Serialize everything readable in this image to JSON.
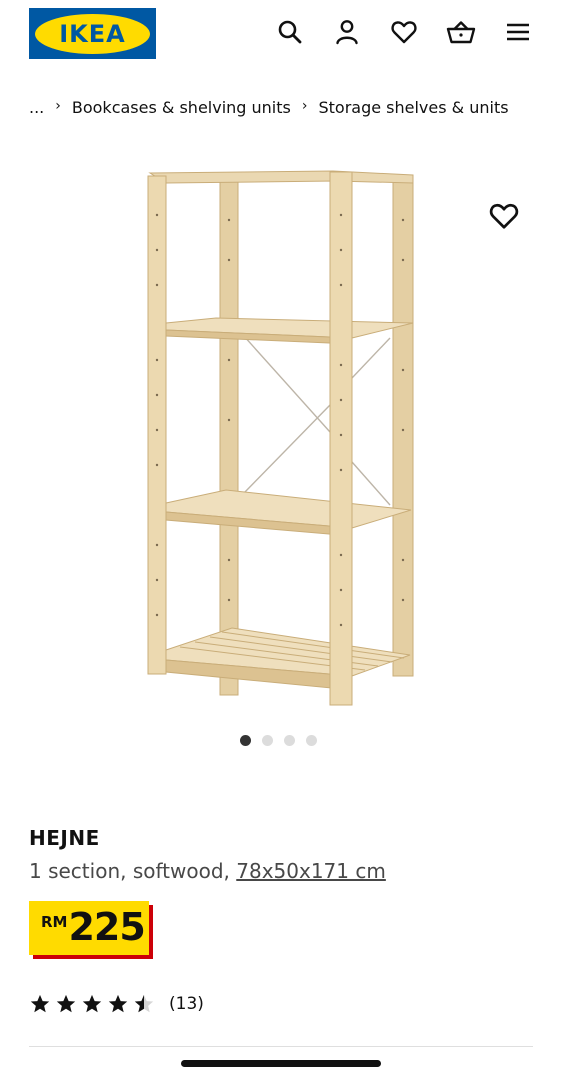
{
  "header": {
    "brand": "IKEA",
    "icons": [
      "search-icon",
      "profile-icon",
      "wishlist-icon",
      "cart-icon",
      "menu-icon"
    ]
  },
  "breadcrumb": {
    "ellipsis": "...",
    "items": [
      "Bookcases & shelving units",
      "Storage shelves & units"
    ]
  },
  "gallery": {
    "image": "shelving unit product image",
    "slides": 4,
    "active_slide": 1
  },
  "product": {
    "name": "HEJNE",
    "description_prefix": "1 section, softwood, ",
    "dimensions": "78x50x171 cm",
    "price_currency": "RM",
    "price_amount": "225",
    "rating_value": 4.5,
    "rating_max": 5,
    "review_count": "(13)"
  },
  "colors": {
    "brand_blue": "#0058a3",
    "brand_yellow": "#ffdb00",
    "price_shadow": "#cc0008"
  }
}
